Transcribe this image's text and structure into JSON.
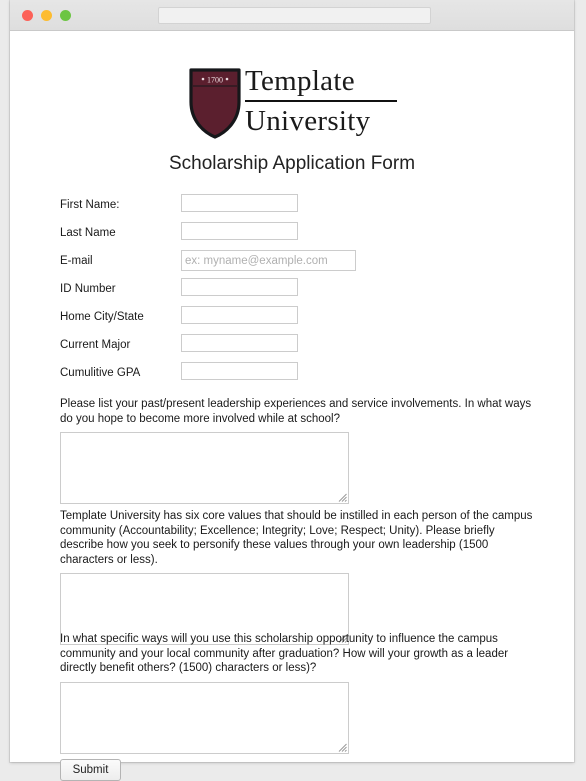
{
  "browser": {
    "traffic_lights": [
      {
        "name": "close",
        "color": "#fc6158"
      },
      {
        "name": "minimize",
        "color": "#fdbc2f"
      },
      {
        "name": "maximize",
        "color": "#6cc543"
      }
    ],
    "address_bar_value": "",
    "address_bar_placeholder": ""
  },
  "logo": {
    "shield_year": "1700",
    "shield_color": "#5b1f2e",
    "wordmark_line1": "Template",
    "wordmark_line2": "University"
  },
  "form": {
    "title": "Scholarship Application Form",
    "fields": [
      {
        "label": "First Name:",
        "value": "",
        "placeholder": "",
        "name": "first-name",
        "wide": false
      },
      {
        "label": "Last Name",
        "value": "",
        "placeholder": "",
        "name": "last-name",
        "wide": false
      },
      {
        "label": "E-mail",
        "value": "",
        "placeholder": "ex: myname@example.com",
        "name": "email",
        "wide": true
      },
      {
        "label": "ID Number",
        "value": "",
        "placeholder": "",
        "name": "id-number",
        "wide": false
      },
      {
        "label": "Home City/State",
        "value": "",
        "placeholder": "",
        "name": "home-city-state",
        "wide": false
      },
      {
        "label": "Current Major",
        "value": "",
        "placeholder": "",
        "name": "current-major",
        "wide": false
      },
      {
        "label": "Cumulitive GPA",
        "value": "",
        "placeholder": "",
        "name": "cumulative-gpa",
        "wide": false
      }
    ],
    "questions": [
      {
        "name": "leadership-experience",
        "text": "Please list your past/present leadership experiences and service involvements. In what ways do you hope to become more involved while at school?",
        "value": ""
      },
      {
        "name": "core-values",
        "text": "Template University has six core values that should be instilled in each person of the campus community (Accountability; Excellence; Integrity; Love; Respect; Unity). Please briefly describe how you seek to personify these values through your own leadership (1500 characters or less).",
        "value": ""
      },
      {
        "name": "community-impact",
        "text": "In what specific ways will you use this scholarship opportunity to influence the campus community and your local community after graduation? How will your growth as a leader directly benefit others? (1500) characters or less)?",
        "value": ""
      }
    ],
    "submit_label": "Submit"
  }
}
